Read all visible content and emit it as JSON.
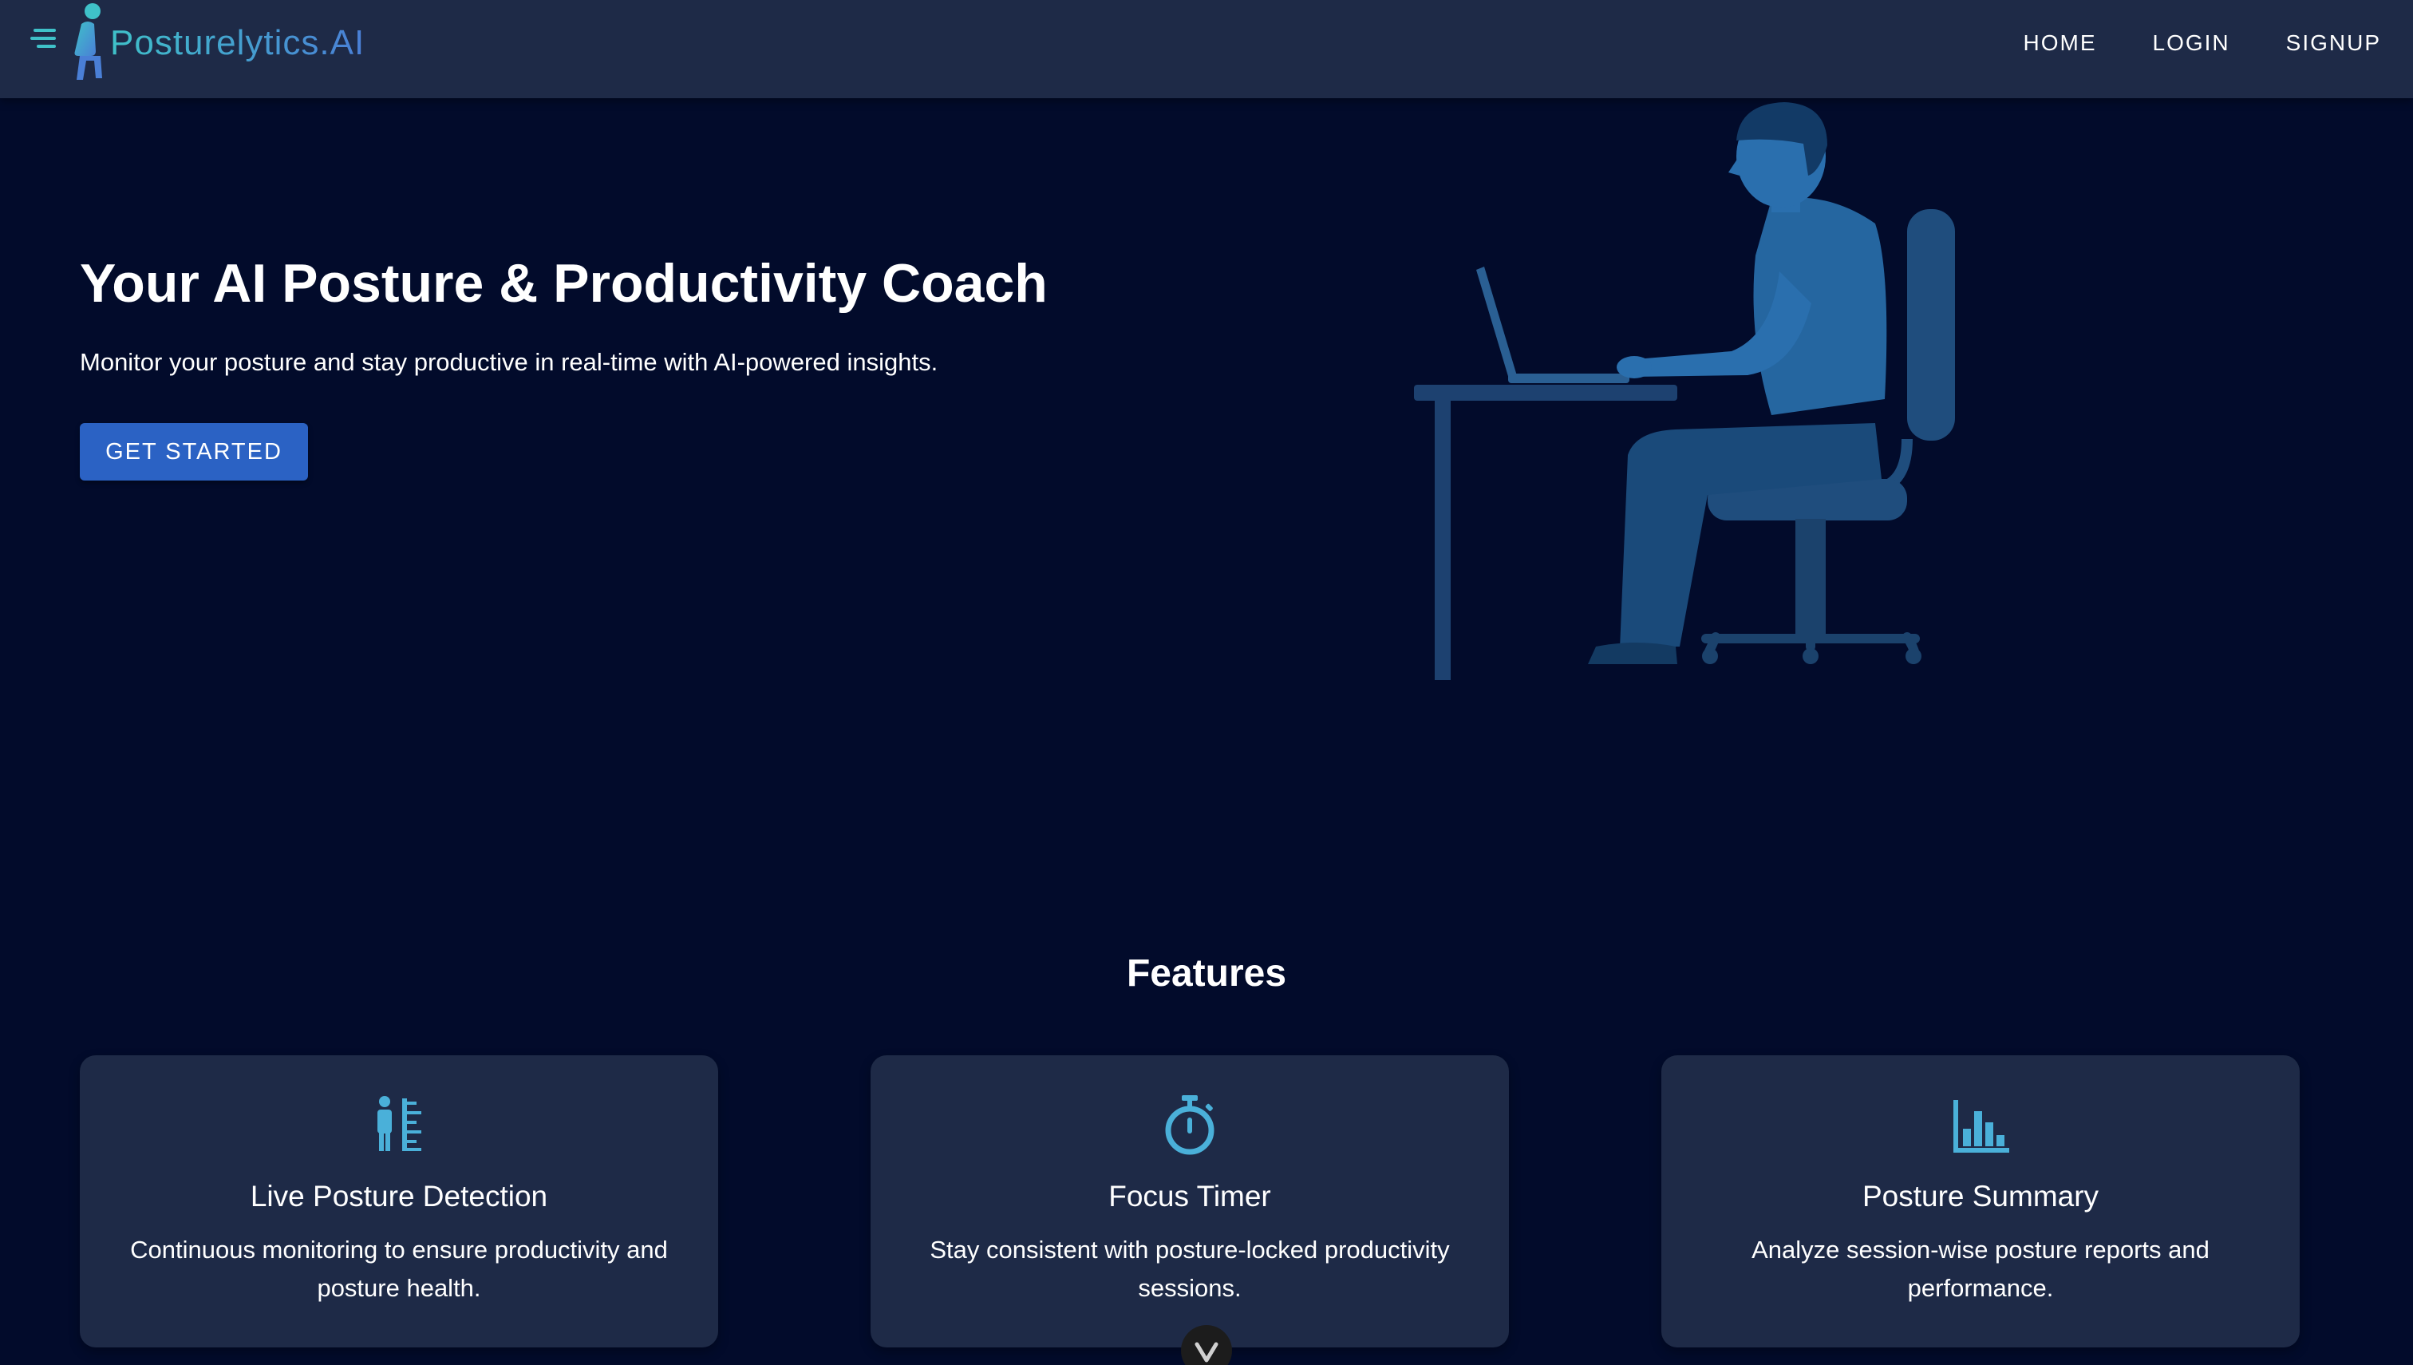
{
  "brand": {
    "name": "Posturelytics.AI",
    "icon": "sitting-person-logo-icon",
    "colors": [
      "#3fc1c9",
      "#4a7fd6"
    ]
  },
  "nav": {
    "links": [
      {
        "label": "HOME"
      },
      {
        "label": "LOGIN"
      },
      {
        "label": "SIGNUP"
      }
    ]
  },
  "hero": {
    "title": "Your AI Posture & Productivity Coach",
    "subtitle": "Monitor your posture and stay productive in real-time with AI-powered insights.",
    "cta_label": "GET STARTED",
    "illustration_icon": "person-at-desk-illustration"
  },
  "features": {
    "heading": "Features",
    "items": [
      {
        "title": "Live Posture Detection",
        "description": "Continuous monitoring to ensure productivity and posture health.",
        "icon": "posture-ruler-icon"
      },
      {
        "title": "Focus Timer",
        "description": "Stay consistent with posture-locked productivity sessions.",
        "icon": "stopwatch-icon"
      },
      {
        "title": "Posture Summary",
        "description": "Analyze session-wise posture reports and performance.",
        "icon": "bar-chart-icon"
      }
    ]
  },
  "scroll": {
    "icon": "chevron-down-icon"
  },
  "colors": {
    "background": "#020b2b",
    "navbar": "#1e2a47",
    "card": "#1e2a47",
    "accent": "#2b62c4",
    "icon": "#4ab0d9"
  }
}
